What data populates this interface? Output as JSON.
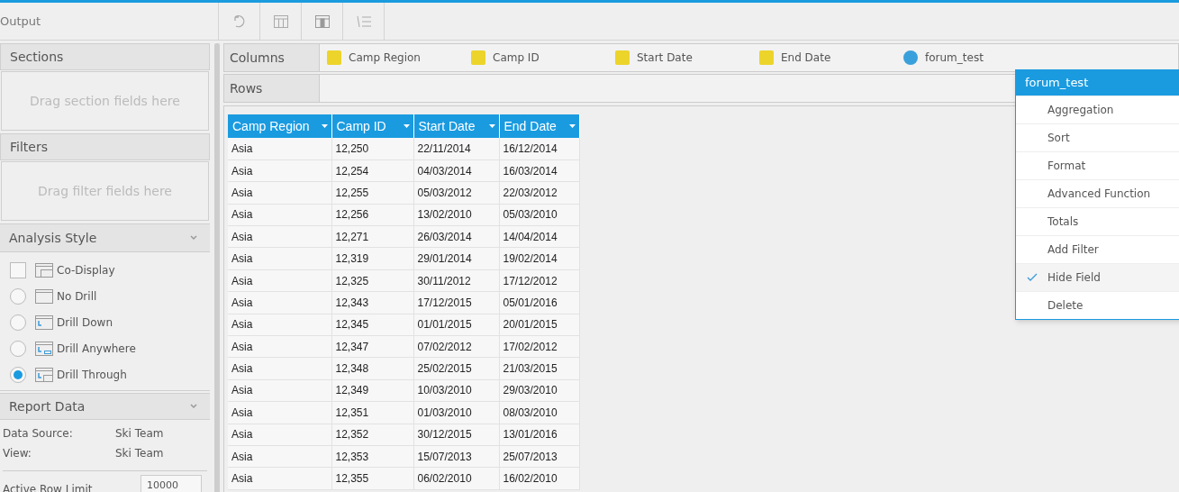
{
  "header": {
    "title": "Output"
  },
  "sections": {
    "title": "Sections",
    "placeholder": "Drag section fields here"
  },
  "filters": {
    "title": "Filters",
    "placeholder": "Drag filter fields here"
  },
  "analysis_style": {
    "title": "Analysis Style",
    "expanded": true,
    "options": [
      {
        "kind": "checkbox",
        "label": "Co-Display",
        "checked": false
      },
      {
        "kind": "radio",
        "label": "No Drill",
        "selected": false
      },
      {
        "kind": "radio",
        "label": "Drill Down",
        "selected": false
      },
      {
        "kind": "radio",
        "label": "Drill Anywhere",
        "selected": false
      },
      {
        "kind": "radio",
        "label": "Drill Through",
        "selected": true
      }
    ]
  },
  "report_data": {
    "title": "Report Data",
    "expanded": true,
    "rows": [
      {
        "label": "Data Source:",
        "value": "Ski Team"
      },
      {
        "label": "View:",
        "value": "Ski Team"
      }
    ],
    "row_limit": {
      "label": "Active Row Limit",
      "value": "10000"
    }
  },
  "columns_bar": {
    "label": "Columns",
    "fields": [
      {
        "kind": "dimension",
        "label": "Camp Region"
      },
      {
        "kind": "dimension",
        "label": "Camp ID"
      },
      {
        "kind": "dimension",
        "label": "Start Date"
      },
      {
        "kind": "dimension",
        "label": "End Date"
      },
      {
        "kind": "metric",
        "label": "forum_test"
      }
    ]
  },
  "rows_bar": {
    "label": "Rows"
  },
  "table": {
    "columns": [
      "Camp Region",
      "Camp ID",
      "Start Date",
      "End Date"
    ],
    "rows": [
      [
        "Asia",
        "12,250",
        "22/11/2014",
        "16/12/2014"
      ],
      [
        "Asia",
        "12,254",
        "04/03/2014",
        "16/03/2014"
      ],
      [
        "Asia",
        "12,255",
        "05/03/2012",
        "22/03/2012"
      ],
      [
        "Asia",
        "12,256",
        "13/02/2010",
        "05/03/2010"
      ],
      [
        "Asia",
        "12,271",
        "26/03/2014",
        "14/04/2014"
      ],
      [
        "Asia",
        "12,319",
        "29/01/2014",
        "19/02/2014"
      ],
      [
        "Asia",
        "12,325",
        "30/11/2012",
        "17/12/2012"
      ],
      [
        "Asia",
        "12,343",
        "17/12/2015",
        "05/01/2016"
      ],
      [
        "Asia",
        "12,345",
        "01/01/2015",
        "20/01/2015"
      ],
      [
        "Asia",
        "12,347",
        "07/02/2012",
        "17/02/2012"
      ],
      [
        "Asia",
        "12,348",
        "25/02/2015",
        "21/03/2015"
      ],
      [
        "Asia",
        "12,349",
        "10/03/2010",
        "29/03/2010"
      ],
      [
        "Asia",
        "12,351",
        "01/03/2010",
        "08/03/2010"
      ],
      [
        "Asia",
        "12,352",
        "30/12/2015",
        "13/01/2016"
      ],
      [
        "Asia",
        "12,353",
        "15/07/2013",
        "25/07/2013"
      ],
      [
        "Asia",
        "12,355",
        "06/02/2010",
        "16/02/2010"
      ]
    ]
  },
  "context_menu": {
    "title": "forum_test",
    "items": [
      {
        "label": "Aggregation",
        "checked": false
      },
      {
        "label": "Sort",
        "checked": false
      },
      {
        "label": "Format",
        "checked": false
      },
      {
        "label": "Advanced Function",
        "checked": false
      },
      {
        "label": "Totals",
        "checked": false
      },
      {
        "label": "Add Filter",
        "checked": false
      },
      {
        "label": "Hide Field",
        "checked": true
      },
      {
        "label": "Delete",
        "checked": false
      }
    ]
  }
}
